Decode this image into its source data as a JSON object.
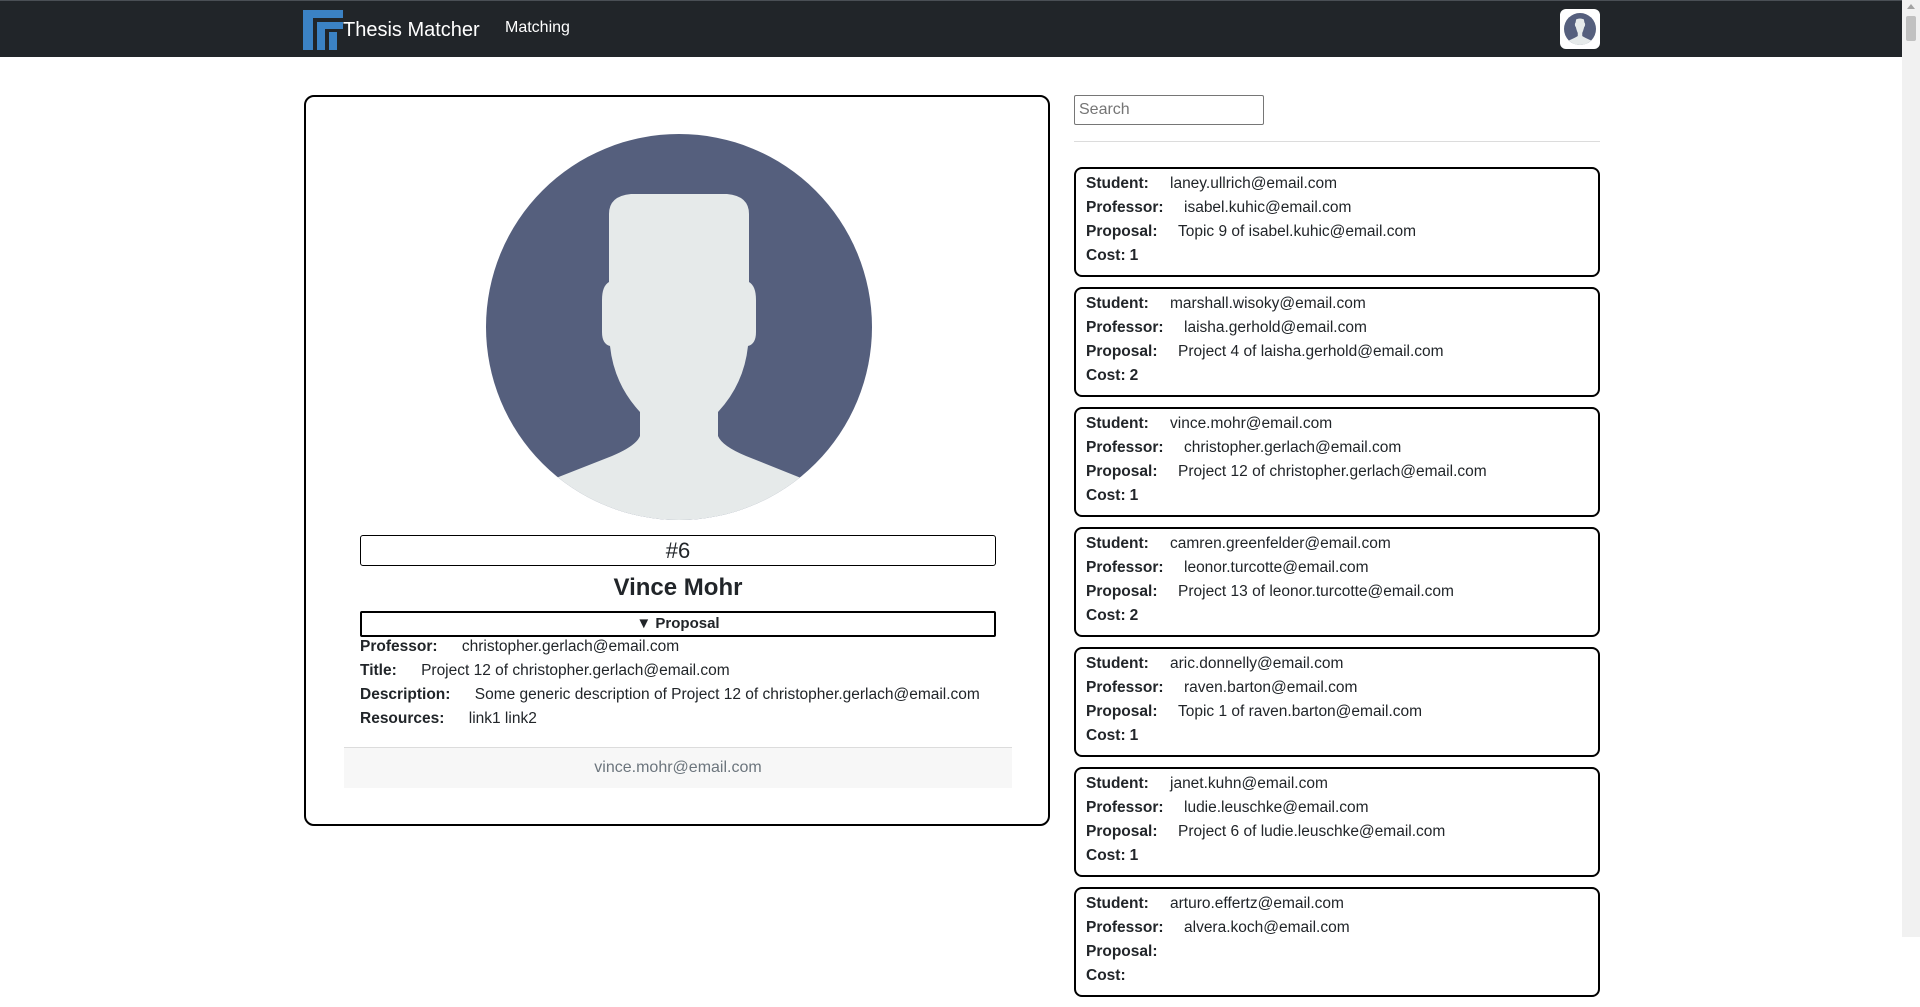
{
  "app": {
    "name": "Thesis Matcher",
    "nav_link": "Matching"
  },
  "profile": {
    "id": "#6",
    "name": "Vince Mohr",
    "proposal_toggle": "▼ Proposal",
    "labels": {
      "professor": "Professor:",
      "title": "Title:",
      "description": "Description:",
      "resources": "Resources:"
    },
    "professor": "christopher.gerlach@email.com",
    "title": "Project 12 of christopher.gerlach@email.com",
    "description": "Some generic description of Project 12 of christopher.gerlach@email.com",
    "resources": "link1 link2",
    "email": "vince.mohr@email.com"
  },
  "search": {
    "placeholder": "Search",
    "value": ""
  },
  "match_labels": {
    "student": "Student:",
    "professor": "Professor:",
    "proposal": "Proposal:",
    "cost": "Cost:"
  },
  "matches": [
    {
      "student": "laney.ullrich@email.com",
      "professor": "isabel.kuhic@email.com",
      "proposal": "Topic 9 of isabel.kuhic@email.com",
      "cost": "1"
    },
    {
      "student": "marshall.wisoky@email.com",
      "professor": "laisha.gerhold@email.com",
      "proposal": "Project 4 of laisha.gerhold@email.com",
      "cost": "2"
    },
    {
      "student": "vince.mohr@email.com",
      "professor": "christopher.gerlach@email.com",
      "proposal": "Project 12 of christopher.gerlach@email.com",
      "cost": "1"
    },
    {
      "student": "camren.greenfelder@email.com",
      "professor": "leonor.turcotte@email.com",
      "proposal": "Project 13 of leonor.turcotte@email.com",
      "cost": "2"
    },
    {
      "student": "aric.donnelly@email.com",
      "professor": "raven.barton@email.com",
      "proposal": "Topic 1 of raven.barton@email.com",
      "cost": "1"
    },
    {
      "student": "janet.kuhn@email.com",
      "professor": "ludie.leuschke@email.com",
      "proposal": "Project 6 of ludie.leuschke@email.com",
      "cost": "1"
    },
    {
      "student": "arturo.effertz@email.com",
      "professor": "alvera.koch@email.com",
      "proposal": "",
      "cost": ""
    }
  ],
  "colors": {
    "navbar": "#212529",
    "logo_blue": "#3b82c4",
    "avatar_bg": "#555f7d",
    "avatar_fg": "#e6eaea"
  }
}
